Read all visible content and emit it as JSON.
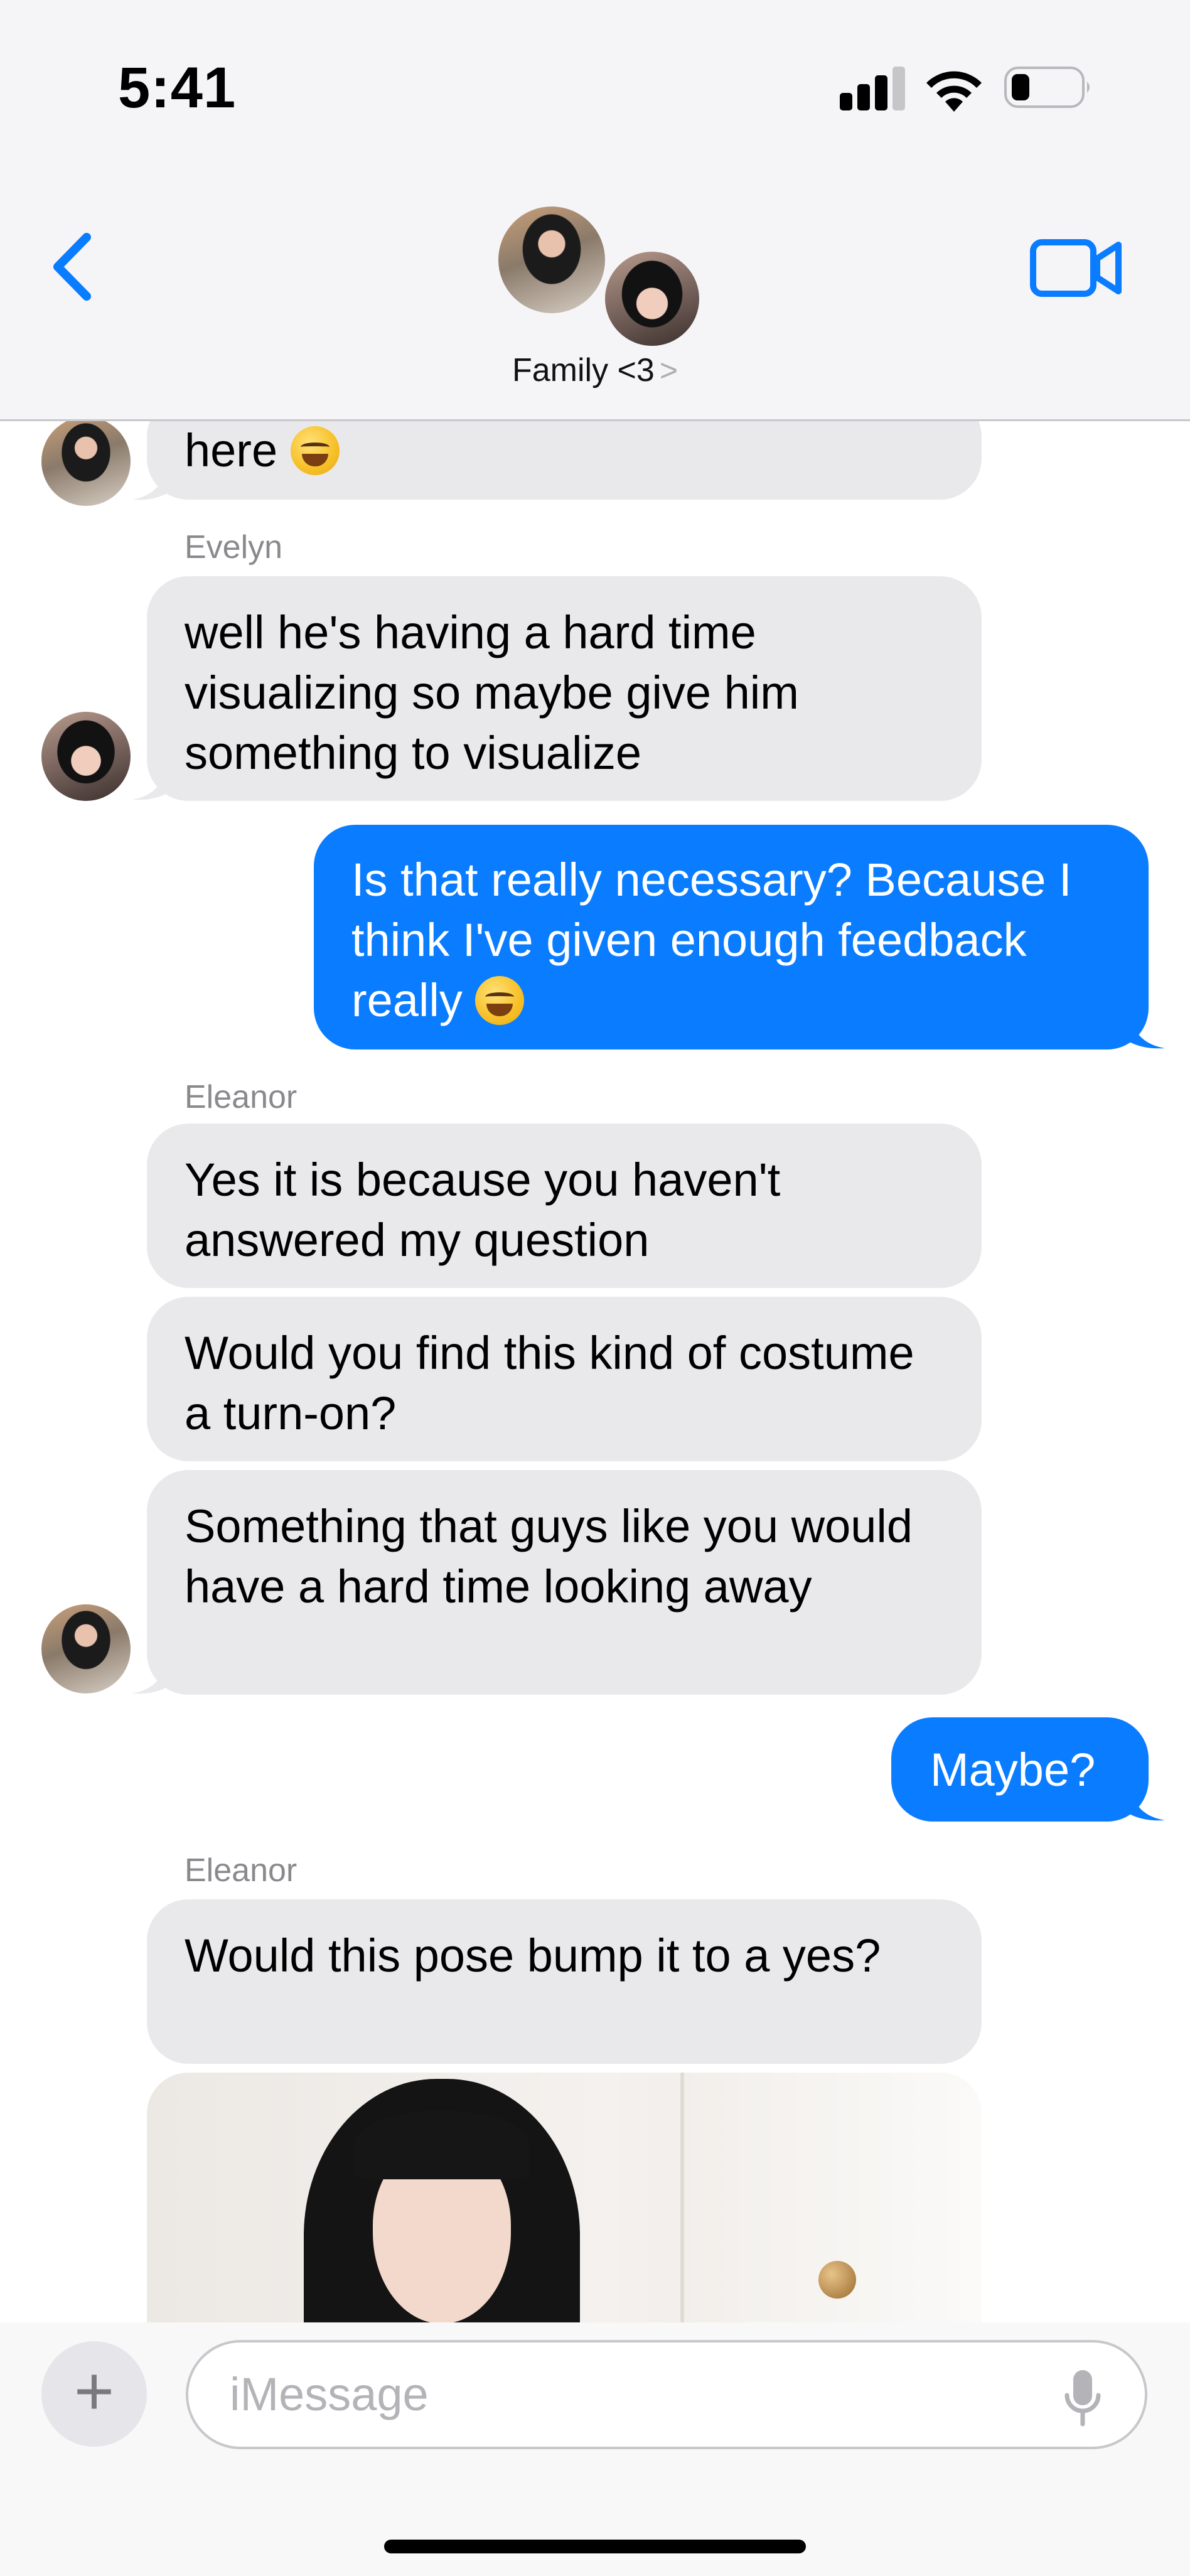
{
  "status_bar": {
    "time": "5:41"
  },
  "header": {
    "group_name": "Family <3",
    "chevron": ">"
  },
  "messages": [
    {
      "sender": "",
      "text": "here"
    },
    {
      "sender": "Evelyn",
      "text": "well he's having a hard time visualizing so maybe give him something to visualize"
    },
    {
      "sender": "me",
      "text": "Is that really necessary? Because I think I've given enough feedback really"
    },
    {
      "sender": "Eleanor",
      "text": "Yes it is because you haven't answered my question"
    },
    {
      "sender": "",
      "text": "Would you find this kind of costume a turn-on?"
    },
    {
      "sender": "",
      "text": "Something that guys like you would have a hard time looking away"
    },
    {
      "sender": "me",
      "text": "Maybe?"
    },
    {
      "sender": "Eleanor",
      "text": "Would this pose bump it to a yes?"
    }
  ],
  "composer": {
    "plus": "+",
    "placeholder": "iMessage"
  },
  "colors": {
    "outgoing": "#0a7cff",
    "incoming": "#e9e9eb",
    "accent": "#0a7cff"
  },
  "icons": [
    "back-chevron-icon",
    "video-camera-icon",
    "mic-icon",
    "signal-icon",
    "wifi-icon",
    "battery-icon",
    "plus-icon"
  ]
}
